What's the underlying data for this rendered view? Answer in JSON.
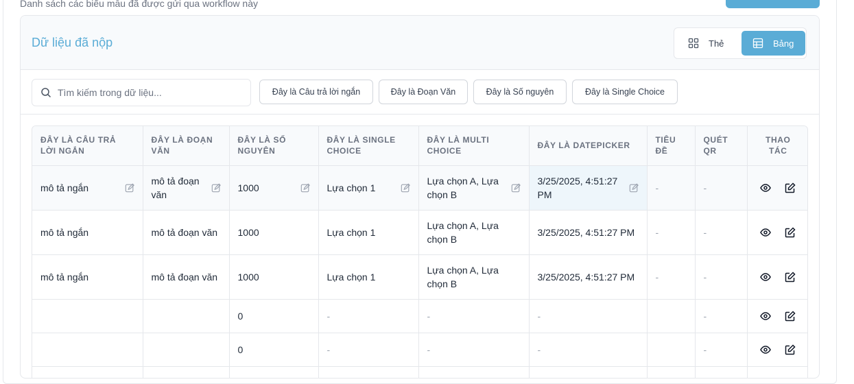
{
  "page": {
    "subtitle": "Danh sách các biểu mẫu đã được gửi qua workflow này"
  },
  "card": {
    "title": "Dữ liệu đã nộp",
    "view_cards_label": "Thẻ",
    "view_table_label": "Bảng"
  },
  "search": {
    "placeholder": "Tìm kiếm trong dữ liệu..."
  },
  "filters": [
    "Đây là Câu trả lời ngắn",
    "Đây là Đoạn Văn",
    "Đây là Số nguyên",
    "Đây là Single Choice"
  ],
  "table": {
    "headers": [
      "Đây là Câu trả lời ngắn",
      "Đây là Đoạn văn",
      "Đây là Số nguyên",
      "Đây là Single Choice",
      "Đây là Multi Choice",
      "Đây là Datepicker",
      "Tiêu đề",
      "Quét QR",
      "Thao tác"
    ],
    "rows": [
      [
        "mô tả ngắn",
        "mô tả đoạn văn",
        "1000",
        "Lựa chọn 1",
        "Lựa chọn A, Lựa chọn B",
        "3/25/2025, 4:51:27 PM",
        "-",
        "-"
      ],
      [
        "mô tả ngắn",
        "mô tả đoạn văn",
        "1000",
        "Lựa chọn 1",
        "Lựa chọn A, Lựa chọn B",
        "3/25/2025, 4:51:27 PM",
        "-",
        "-"
      ],
      [
        "mô tả ngắn",
        "mô tả đoạn văn",
        "1000",
        "Lựa chọn 1",
        "Lựa chọn A, Lựa chọn B",
        "3/25/2025, 4:51:27 PM",
        "-",
        "-"
      ],
      [
        "",
        "",
        "0",
        "-",
        "-",
        "-",
        "",
        "-"
      ],
      [
        "",
        "",
        "0",
        "-",
        "-",
        "-",
        "",
        "-"
      ]
    ]
  },
  "colors": {
    "accent": "#5aacd6",
    "border": "#e5e7eb",
    "header_bg": "#f8fafc"
  }
}
